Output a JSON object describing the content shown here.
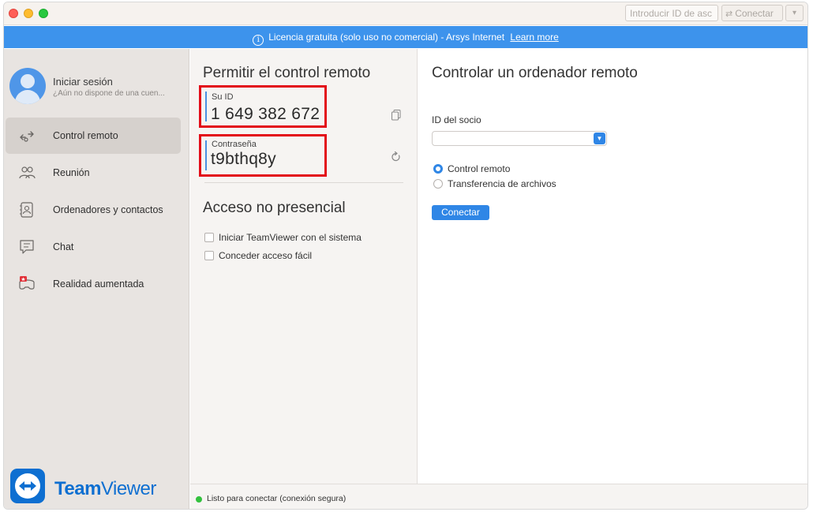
{
  "titlebar": {
    "partner_id_placeholder": "Introducir ID de asc",
    "connect_label": "Conectar",
    "dropdown_icon": "chevron-down-icon"
  },
  "banner": {
    "text": "Licencia gratuita (solo uso no comercial) - Arsys Internet",
    "link": "Learn more",
    "background": "#3d93ec"
  },
  "account": {
    "title": "Iniciar sesión",
    "subtitle": "¿Aún no dispone de una cuen..."
  },
  "sidebar": {
    "items": [
      {
        "label": "Control remoto",
        "icon": "remote-control-icon",
        "active": true
      },
      {
        "label": "Reunión",
        "icon": "meeting-icon",
        "active": false
      },
      {
        "label": "Ordenadores y contactos",
        "icon": "contacts-icon",
        "active": false
      },
      {
        "label": "Chat",
        "icon": "chat-icon",
        "active": false
      },
      {
        "label": "Realidad aumentada",
        "icon": "augmented-reality-icon",
        "active": false
      }
    ]
  },
  "brand": {
    "name_bold": "Team",
    "name_regular": "Viewer",
    "color": "#0e6fd1"
  },
  "allow_remote": {
    "title": "Permitir el control remoto",
    "id_label": "Su ID",
    "id_value": "1 649 382 672",
    "password_label": "Contraseña",
    "password_value": "t9bthq8y"
  },
  "unattended": {
    "title": "Acceso no presencial",
    "options": [
      {
        "label": "Iniciar TeamViewer con el sistema",
        "checked": false
      },
      {
        "label": "Conceder acceso fácil",
        "checked": false
      }
    ]
  },
  "control_remote": {
    "title": "Controlar un ordenador remoto",
    "partner_id_label": "ID del socio",
    "partner_id_value": "",
    "modes": [
      {
        "label": "Control remoto",
        "selected": true
      },
      {
        "label": "Transferencia de archivos",
        "selected": false
      }
    ],
    "connect_label": "Conectar"
  },
  "status": {
    "text": "Listo para conectar (conexión segura)",
    "color": "#33c13e"
  },
  "highlight_color": "#e30b17"
}
